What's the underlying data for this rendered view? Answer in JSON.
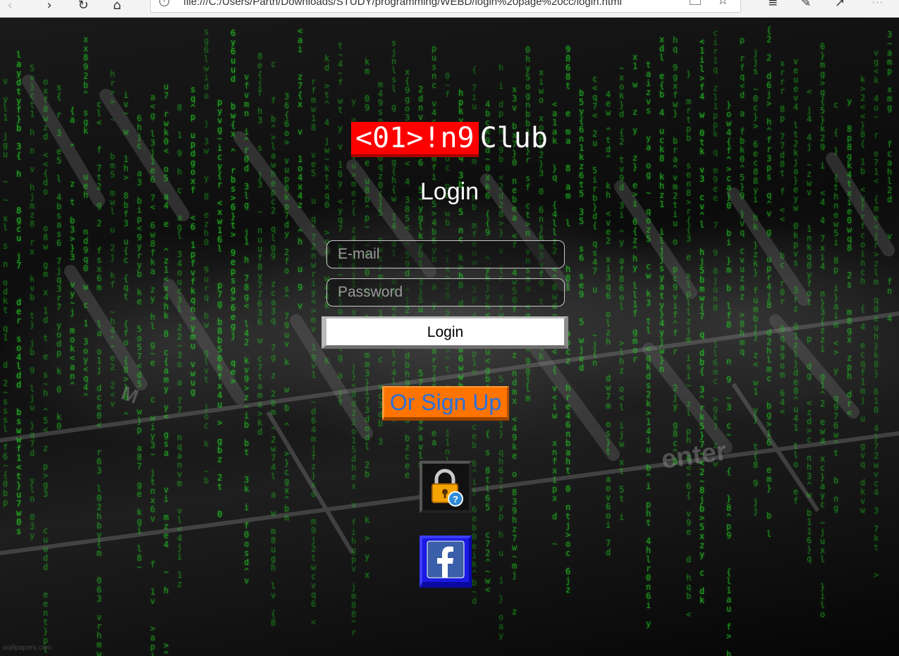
{
  "browser": {
    "url": "file:///C:/Users/Parth/Downloads/STUDY/programming/WEBD/login%20page%20cc/login.html"
  },
  "brand": {
    "highlight": "<01>!n9",
    "rest": "Club",
    "highlight_color": "#ff0000"
  },
  "form": {
    "heading": "Login",
    "email_placeholder": "E-mail",
    "password_placeholder": "Password",
    "login_label": "Login",
    "signup_label": "Or Sign Up"
  },
  "icons": {
    "lock": "lock-help-icon",
    "facebook": "facebook-icon"
  },
  "background": {
    "watermark": "wallpapers.com",
    "matrix_color": "#28c828"
  }
}
